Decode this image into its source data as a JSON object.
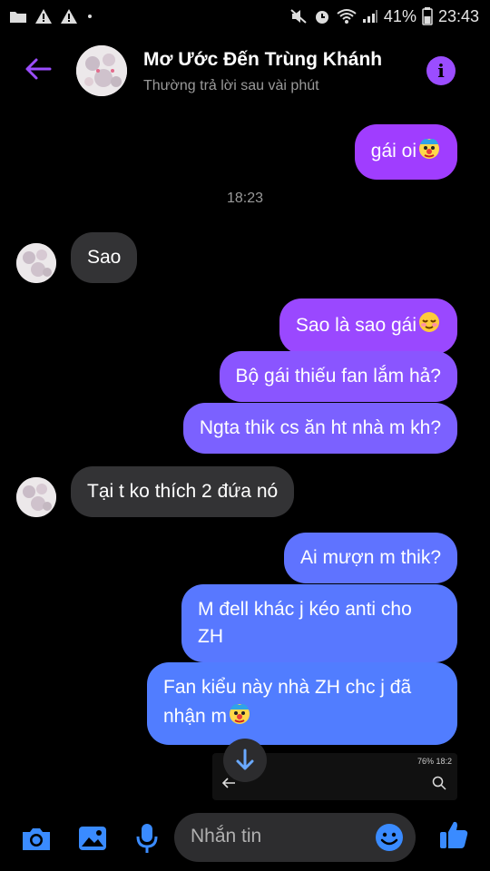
{
  "status_bar": {
    "battery": "41%",
    "time": "23:43"
  },
  "header": {
    "name": "Mơ Ước Đến Trùng Khánh",
    "subtitle": "Thường trả lời sau vài phút",
    "info_icon": "info-icon",
    "back_icon": "back-arrow-icon"
  },
  "colors": {
    "accent": "#9b4dff",
    "bubble_top": "#a03dff",
    "bubble_bottom": "#4f7dff",
    "incoming": "#333335"
  },
  "messages": [
    {
      "side": "out",
      "text": "gái oi",
      "emoji": "clown-face"
    },
    {
      "side": "in",
      "text": "Sao"
    },
    {
      "side": "out",
      "text": "Sao là sao gái",
      "emoji": "relieved-face"
    },
    {
      "side": "out",
      "text": "Bộ gái thiếu fan lắm hả?"
    },
    {
      "side": "out",
      "text": "Ngta thik cs ăn ht nhà m kh?"
    },
    {
      "side": "in",
      "text": "Tại t ko thích 2 đứa nó"
    },
    {
      "side": "out",
      "text": "Ai mượn m thik?"
    },
    {
      "side": "out",
      "text": "M đell khác j kéo anti cho ZH"
    },
    {
      "side": "out",
      "text": "Fan kiểu này nhà ZH chc j đã nhận m",
      "emoji": "clown-face"
    }
  ],
  "timestamp": "18:23",
  "preview": {
    "status": "76%  18:2"
  },
  "composer": {
    "placeholder": "Nhắn tin",
    "icons": [
      "camera-icon",
      "gallery-icon",
      "microphone-icon",
      "emoji-icon",
      "thumbs-up-icon"
    ]
  }
}
